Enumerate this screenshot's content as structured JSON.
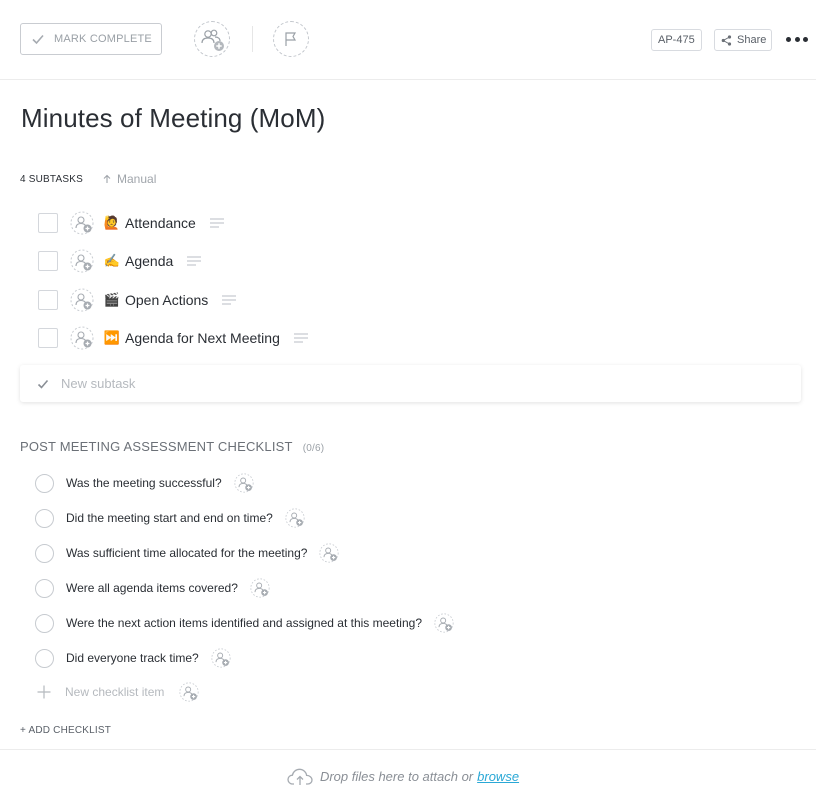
{
  "toolbar": {
    "mark_complete_label": "MARK COMPLETE",
    "task_id": "AP-475",
    "share_label": "Share"
  },
  "task": {
    "title": "Minutes of Meeting (MoM)"
  },
  "subtasks": {
    "count_label": "4 SUBTASKS",
    "sort_label": "Manual",
    "items": [
      {
        "emoji": "🙋",
        "name": "Attendance"
      },
      {
        "emoji": "✍️",
        "name": "Agenda"
      },
      {
        "emoji": "🎬",
        "name": "Open Actions"
      },
      {
        "emoji": "⏭️",
        "name": "Agenda for Next Meeting"
      }
    ],
    "new_placeholder": "New subtask"
  },
  "checklist": {
    "title": "POST MEETING ASSESSMENT CHECKLIST",
    "progress": "(0/6)",
    "items": [
      {
        "text": "Was the meeting successful?"
      },
      {
        "text": "Did the meeting start and end on time?"
      },
      {
        "text": "Was sufficient time allocated for the meeting?"
      },
      {
        "text": "Were all agenda items covered?"
      },
      {
        "text": "Were the next action items identified and assigned at this meeting?"
      },
      {
        "text": "Did everyone track time?"
      }
    ],
    "new_item_placeholder": "New checklist item",
    "add_checklist_label": "+ ADD CHECKLIST"
  },
  "attachments": {
    "drop_text": "Drop files here to attach or",
    "browse_label": "browse"
  },
  "colors": {
    "link": "#2aa8d6",
    "border": "#c9ccd1",
    "text": "#2a2e34",
    "muted": "#9aa0a6"
  }
}
